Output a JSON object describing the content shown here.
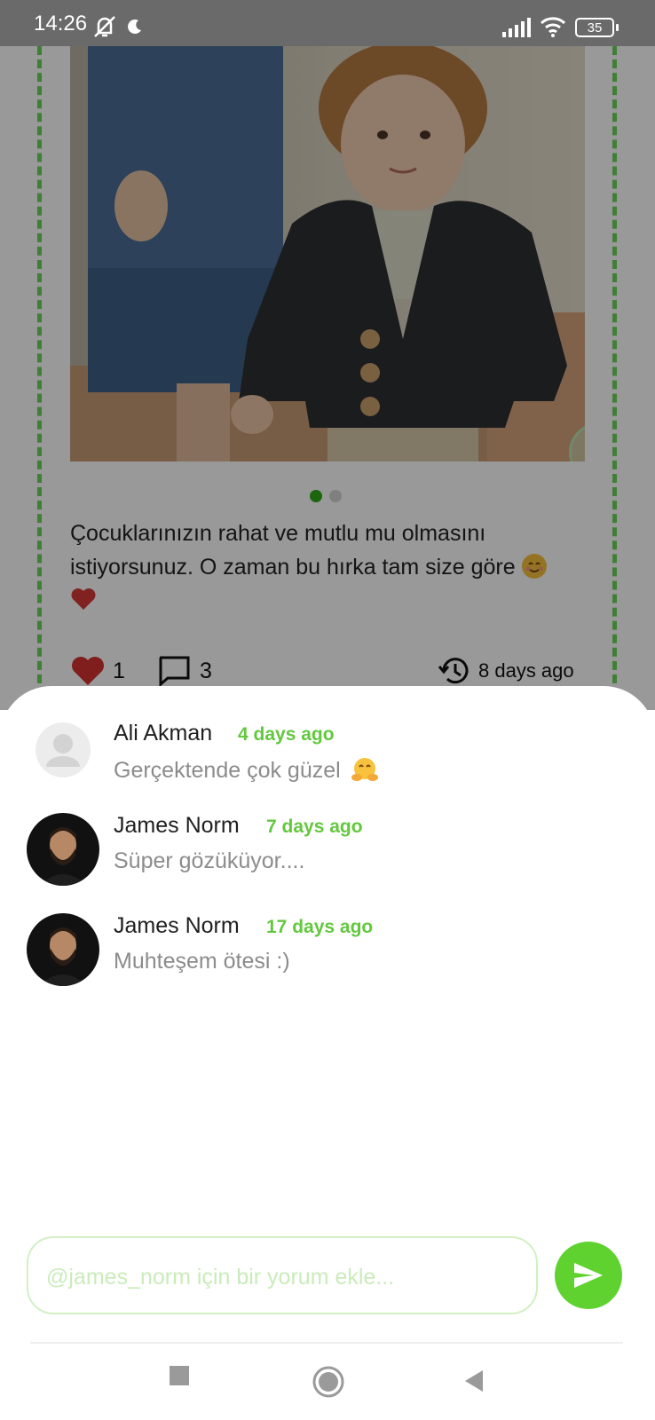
{
  "status_bar": {
    "time": "14:26",
    "battery": "35",
    "icons": [
      "mute-icon",
      "moon-icon",
      "signal-icon",
      "wifi-icon",
      "battery-icon"
    ]
  },
  "post": {
    "image_dots": {
      "count": 2,
      "active_index": 0
    },
    "caption": "Çocuklarınızın rahat ve mutlu mu olmasını istiyorsunuz. O zaman bu hırka tam size göre",
    "likes": "1",
    "comments": "3",
    "time_ago": "8 days ago"
  },
  "comments": [
    {
      "name": "Ali Akman",
      "time": "4 days ago",
      "text": "Gerçektende çok güzel",
      "avatar": "placeholder"
    },
    {
      "name": "James Norm",
      "time": "7 days ago",
      "text": "Süper gözüküyor....",
      "avatar": "photo"
    },
    {
      "name": "James Norm",
      "time": "17 days ago",
      "text": "Muhteşem ötesi :)",
      "avatar": "photo"
    }
  ],
  "input": {
    "placeholder": "@james_norm için bir yorum ekle...",
    "value": ""
  },
  "colors": {
    "accent": "#5fd230",
    "time_green": "#62c83e",
    "dashed_border": "#6cd45a"
  }
}
